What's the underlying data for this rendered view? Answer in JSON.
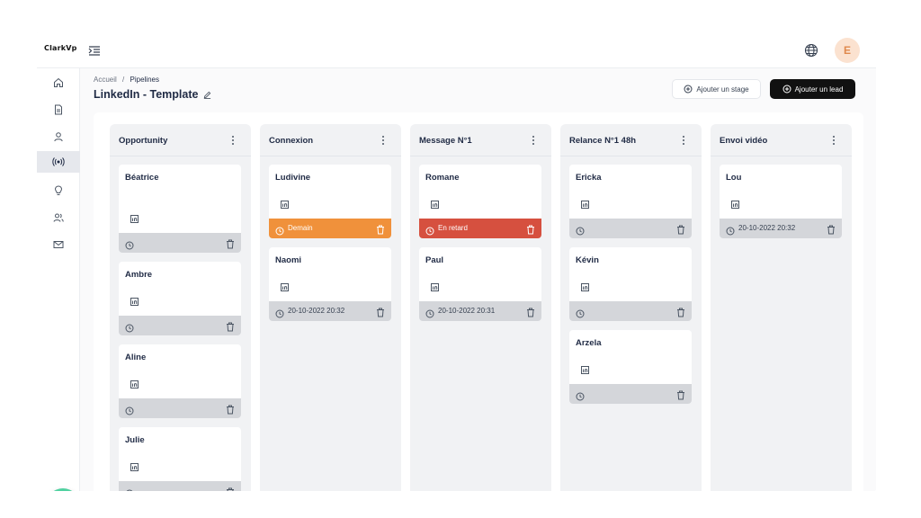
{
  "app": {
    "logo_text": "ClarkVp",
    "avatar_initial": "E"
  },
  "icons": {
    "menu_toggle": "menu-indent-icon",
    "language": "globe-icon",
    "notifications": "bell-icon",
    "sidebar": [
      "home-icon",
      "document-icon",
      "user-icon",
      "broadcast-icon",
      "lightbulb-icon",
      "users-icon",
      "mail-icon"
    ]
  },
  "colors": {
    "accent_dark": "#111111",
    "overdue": "#d6503f",
    "due_soon": "#f0913b",
    "notify": "#4fd1a0",
    "avatar_bg": "#fbe2d0"
  },
  "breadcrumb": {
    "home": "Accueil",
    "separator": "/",
    "current": "Pipelines"
  },
  "page": {
    "title": "LinkedIn - Template"
  },
  "actions": {
    "add_stage": "Ajouter un stage",
    "add_lead": "Ajouter un lead"
  },
  "columns": [
    {
      "title": "Opportunity",
      "cards": [
        {
          "name": "Béatrice",
          "footer_text": "",
          "status": "none"
        },
        {
          "name": "Ambre",
          "footer_text": "",
          "status": "none"
        },
        {
          "name": "Aline",
          "footer_text": "",
          "status": "none"
        },
        {
          "name": "Julie",
          "footer_text": "",
          "status": "none"
        }
      ]
    },
    {
      "title": "Connexion",
      "cards": [
        {
          "name": "Ludivine",
          "footer_text": "Demain",
          "status": "soon"
        },
        {
          "name": "Naomi",
          "footer_text": "20-10-2022 20:32",
          "status": "none"
        }
      ]
    },
    {
      "title": "Message N°1",
      "cards": [
        {
          "name": "Romane",
          "footer_text": "En retard",
          "status": "late"
        },
        {
          "name": "Paul",
          "footer_text": "20-10-2022 20:31",
          "status": "none"
        }
      ]
    },
    {
      "title": "Relance N°1 48h",
      "cards": [
        {
          "name": "Ericka",
          "footer_text": "",
          "status": "none"
        },
        {
          "name": "Kévin",
          "footer_text": "",
          "status": "none"
        },
        {
          "name": "Arzela",
          "footer_text": "",
          "status": "none"
        }
      ]
    },
    {
      "title": "Envoi vidéo",
      "cards": [
        {
          "name": "Lou",
          "footer_text": "20-10-2022 20:32",
          "status": "none"
        }
      ]
    }
  ]
}
